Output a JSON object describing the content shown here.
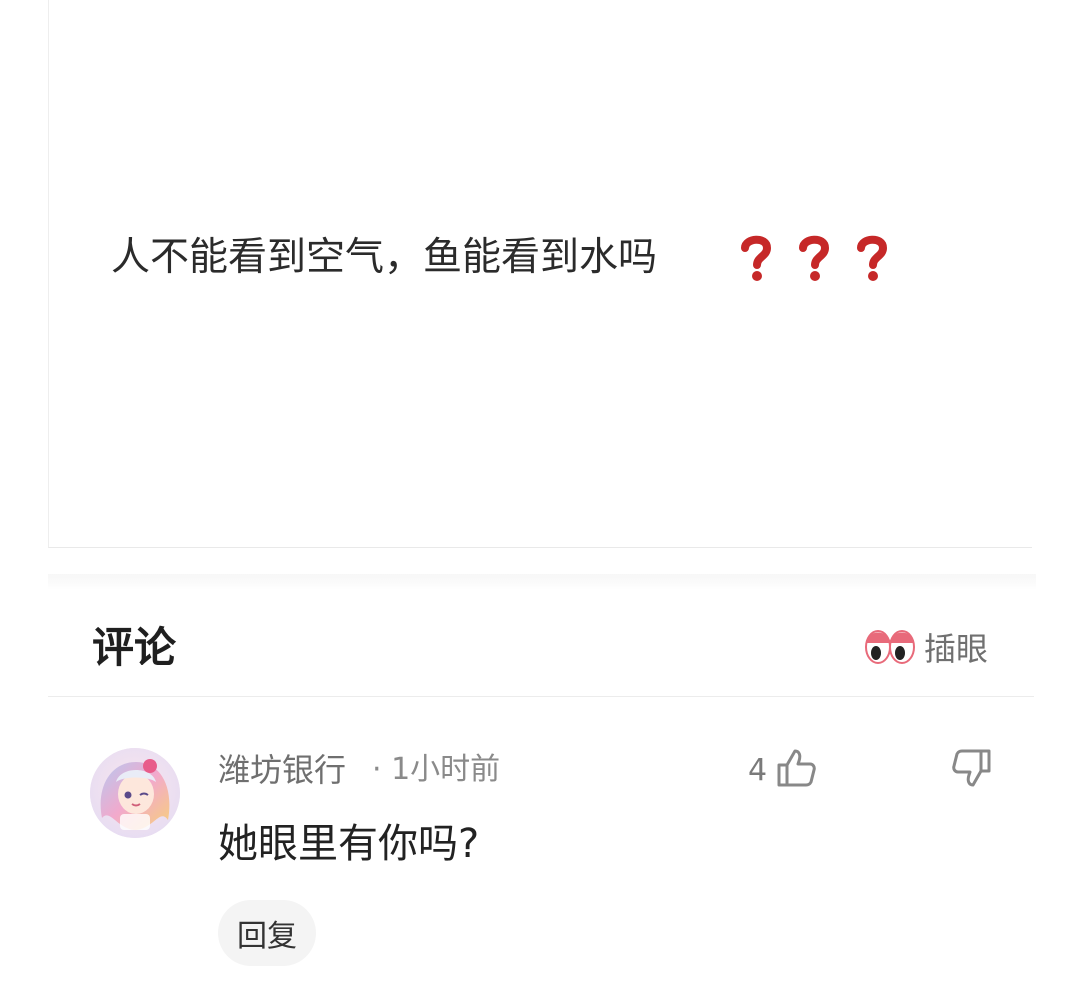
{
  "post": {
    "text": "人不能看到空气，鱼能看到水吗",
    "trailing_icons": [
      "red-question-mark-icon",
      "red-question-mark-icon",
      "red-question-mark-icon"
    ]
  },
  "comments_section": {
    "title": "评论",
    "peek_button": {
      "icon": "eyes-icon",
      "label": "插眼"
    }
  },
  "comments": [
    {
      "author": "潍坊银行",
      "time": "· 1小时前",
      "text": "她眼里有你吗?",
      "likes": "4",
      "reply_label": "回复",
      "avatar_icon": "anime-avatar"
    }
  ],
  "colors": {
    "question_mark": "#c62828",
    "eye_lid": "#e86a7a",
    "muted_text": "#707070"
  }
}
